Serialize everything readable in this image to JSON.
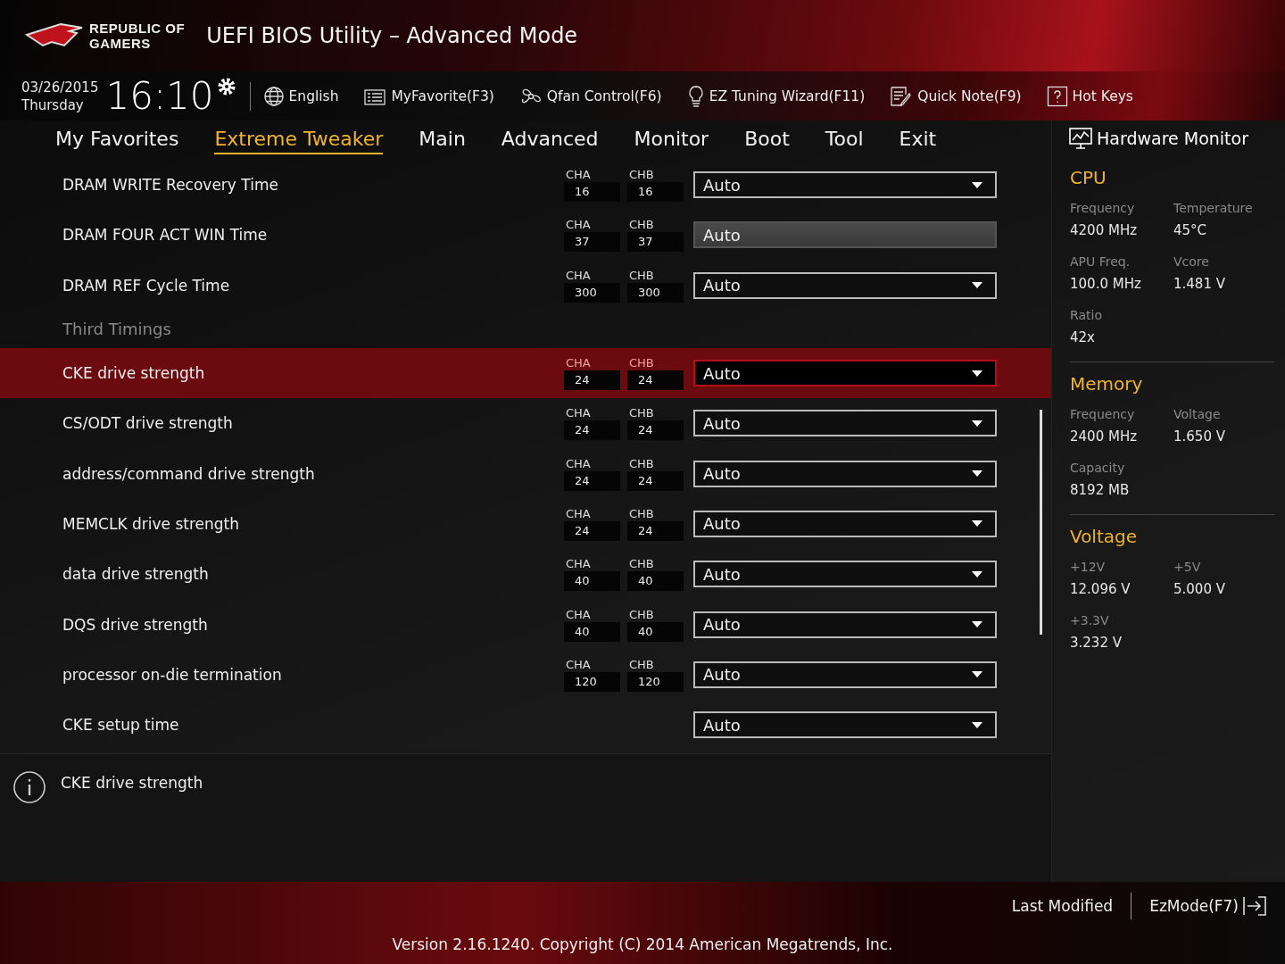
{
  "brand": {
    "line_1": "REPUBLIC OF",
    "line_2": "GAMERS"
  },
  "window": {
    "title": "UEFI BIOS Utility – Advanced Mode"
  },
  "clock": {
    "date": "03/26/2015",
    "day": "Thursday",
    "time": "16:10"
  },
  "toolbar": [
    {
      "kind": "globe",
      "label": "English"
    },
    {
      "kind": "favorite",
      "label": "MyFavorite(F3)"
    },
    {
      "kind": "fan",
      "label": "Qfan Control(F6)"
    },
    {
      "kind": "bulb",
      "label": "EZ Tuning Wizard(F11)"
    },
    {
      "kind": "note",
      "label": "Quick Note(F9)"
    },
    {
      "kind": "help",
      "label": "Hot Keys"
    }
  ],
  "tabs": [
    {
      "label": "My Favorites",
      "selected": false
    },
    {
      "label": "Extreme Tweaker",
      "selected": true
    },
    {
      "label": "Main",
      "selected": false
    },
    {
      "label": "Advanced",
      "selected": false
    },
    {
      "label": "Monitor",
      "selected": false
    },
    {
      "label": "Boot",
      "selected": false
    },
    {
      "label": "Tool",
      "selected": false
    },
    {
      "label": "Exit",
      "selected": false
    }
  ],
  "settings": [
    {
      "kind": "setting",
      "label": "DRAM WRITE Recovery Time",
      "cha": {
        "label": "CHA",
        "value": "16"
      },
      "chb": {
        "label": "CHB",
        "value": "16"
      },
      "value": "Auto",
      "selected": false,
      "disabled": false
    },
    {
      "kind": "setting",
      "label": "DRAM FOUR ACT WIN Time",
      "cha": {
        "label": "CHA",
        "value": "37"
      },
      "chb": {
        "label": "CHB",
        "value": "37"
      },
      "value": "Auto",
      "selected": false,
      "disabled": true
    },
    {
      "kind": "setting",
      "label": "DRAM REF Cycle Time",
      "cha": {
        "label": "CHA",
        "value": "300"
      },
      "chb": {
        "label": "CHB",
        "value": "300"
      },
      "value": "Auto",
      "selected": false,
      "disabled": false
    },
    {
      "kind": "heading",
      "label": "Third Timings"
    },
    {
      "kind": "setting",
      "label": "CKE drive strength",
      "cha": {
        "label": "CHA",
        "value": "24"
      },
      "chb": {
        "label": "CHB",
        "value": "24"
      },
      "value": "Auto",
      "selected": true,
      "disabled": false
    },
    {
      "kind": "setting",
      "label": "CS/ODT drive strength",
      "cha": {
        "label": "CHA",
        "value": "24"
      },
      "chb": {
        "label": "CHB",
        "value": "24"
      },
      "value": "Auto",
      "selected": false,
      "disabled": false
    },
    {
      "kind": "setting",
      "label": "address/command drive strength",
      "cha": {
        "label": "CHA",
        "value": "24"
      },
      "chb": {
        "label": "CHB",
        "value": "24"
      },
      "value": "Auto",
      "selected": false,
      "disabled": false
    },
    {
      "kind": "setting",
      "label": "MEMCLK drive strength",
      "cha": {
        "label": "CHA",
        "value": "24"
      },
      "chb": {
        "label": "CHB",
        "value": "24"
      },
      "value": "Auto",
      "selected": false,
      "disabled": false
    },
    {
      "kind": "setting",
      "label": "data drive strength",
      "cha": {
        "label": "CHA",
        "value": "40"
      },
      "chb": {
        "label": "CHB",
        "value": "40"
      },
      "value": "Auto",
      "selected": false,
      "disabled": false
    },
    {
      "kind": "setting",
      "label": "DQS drive strength",
      "cha": {
        "label": "CHA",
        "value": "40"
      },
      "chb": {
        "label": "CHB",
        "value": "40"
      },
      "value": "Auto",
      "selected": false,
      "disabled": false
    },
    {
      "kind": "setting",
      "label": "processor on-die termination",
      "cha": {
        "label": "CHA",
        "value": "120"
      },
      "chb": {
        "label": "CHB",
        "value": "120"
      },
      "value": "Auto",
      "selected": false,
      "disabled": false
    },
    {
      "kind": "setting",
      "label": "CKE setup time",
      "value": "Auto",
      "selected": false,
      "disabled": false
    }
  ],
  "help_text": "CKE drive strength",
  "hardware_monitor": {
    "title": "Hardware Monitor",
    "sections": [
      {
        "title": "CPU",
        "items": [
          {
            "label": "Frequency",
            "value": "4200 MHz"
          },
          {
            "label": "Temperature",
            "value": "45°C"
          },
          {
            "label": "APU Freq.",
            "value": "100.0 MHz"
          },
          {
            "label": "Vcore",
            "value": "1.481 V"
          },
          {
            "label": "Ratio",
            "value": "42x"
          }
        ]
      },
      {
        "title": "Memory",
        "items": [
          {
            "label": "Frequency",
            "value": "2400 MHz"
          },
          {
            "label": "Voltage",
            "value": "1.650 V"
          },
          {
            "label": "Capacity",
            "value": "8192 MB"
          }
        ]
      },
      {
        "title": "Voltage",
        "items": [
          {
            "label": "+12V",
            "value": "12.096 V"
          },
          {
            "label": "+5V",
            "value": "5.000 V"
          },
          {
            "label": "+3.3V",
            "value": "3.232 V"
          }
        ]
      }
    ]
  },
  "footer": {
    "last_modified": "Last Modified",
    "ez_mode": "EzMode(F7)",
    "version": "Version 2.16.1240. Copyright (C) 2014 American Megatrends, Inc."
  }
}
